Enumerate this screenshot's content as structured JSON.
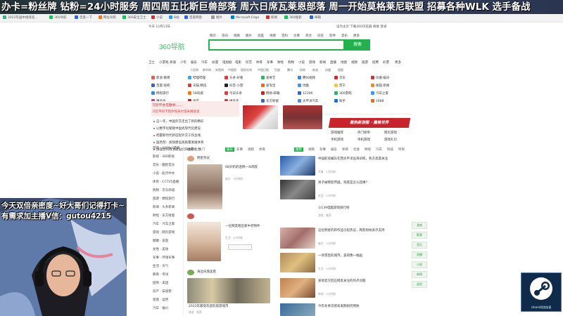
{
  "stream_banner": "办卡=粉丝牌  钻粉=24小时服务 周四周五比斯巨兽部落 周六日席瓦莱恩部落 周一开始莫格莱尼联盟 招募各种WLK 选手备战",
  "bookmarks": [
    "2022年国中组排名...",
    "360导航",
    "百度一下",
    "网址导航",
    "360安全卫士",
    "小说",
    "B站",
    "百度网盘",
    "图片",
    "Microsoft Edge",
    "新闻",
    "360搜索",
    "邮箱"
  ],
  "browser": {
    "logo_main": "360",
    "logo_suffix": "导航",
    "search_tabs": [
      "网页",
      "资讯",
      "视频",
      "图片",
      "良医",
      "地图",
      "百科",
      "文库",
      "英文",
      "问答",
      "软件",
      "音乐",
      "更多"
    ],
    "search_button": "搜索",
    "top_right": [
      "设为主页",
      "下载360浏览器",
      "换肤",
      "登录"
    ],
    "header_left": "今天 12月13日",
    "nav_items": [
      "卫士",
      "小游戏",
      "商城",
      "少年",
      "娱乐",
      "汽车",
      "动漫",
      "电视剧",
      "电影",
      "综艺",
      "体育",
      "军事",
      "财经",
      "购物",
      "小说",
      "游戏",
      "新闻",
      "直播",
      "地图",
      "视频",
      "旅游",
      "招聘",
      "彩票",
      "更多"
    ],
    "hotlinks_row1": [
      "人民网",
      "新华网",
      "央视网",
      "中国网",
      "国际在线",
      "中国日报",
      "百度",
      "腾讯",
      "网易",
      "新浪",
      "凤凰",
      "搜狐"
    ],
    "sites": [
      [
        "新浪·微博",
        "哔哩哔哩",
        "头条·好看",
        "爱奇艺",
        "腾讯视频",
        "京东",
        "凤凰·娱乐"
      ],
      [
        "百度·贴吧",
        "天猫·精选",
        "抖音·小游",
        "爱淘宝",
        "优酷",
        "苏宁",
        "搜狐·新闻"
      ],
      [
        "携程旅行",
        "58同城",
        "今日头条",
        "网易·邮箱",
        "12306",
        "360游戏",
        "汽车之家"
      ],
      [
        "唯品会",
        "国美",
        "拼多多",
        "东方财富",
        "太平洋汽车",
        "知乎",
        "1688"
      ]
    ],
    "headline_main": "习近平会见欧洲……",
    "headlines": [
      "习近平同卡塔尔埃米尔塔米姆会谈",
      "这一年，中国外交走出了新的精彩",
      "以数字化赋能中国式现代化建设",
      "把握新时代新征程外交工作主线",
      "国务院：加快建设高质量发展体系",
      "加强党的政治建设提升执政能力"
    ],
    "game_banner": "最热新游服 · 魔兽世界",
    "game_links": [
      "游戏推荐",
      "热门榜单",
      "网页游戏",
      "手机游戏",
      "单机游戏",
      "游戏礼包"
    ],
    "left_menu": [
      "游戏 · 4399小游戏",
      "影视 · 360影视",
      "音乐 · 酷狗音乐",
      "小说 · 起点中文",
      "体育 · CCTV5直播",
      "购物 · 京东商城",
      "旅游 · 携程旅行",
      "新闻 · 头条新闻",
      "财经 · 东方财富",
      "汽车 · 汽车之家",
      "游戏 · 网页游戏",
      "健康 · 良医",
      "女性 · 美妆",
      "军事 · 环球军事",
      "生活 · 天气",
      "教育 · 考试",
      "团购 · 美团",
      "房产 · 安居客",
      "星座 · 运势",
      "汽车 · 报价"
    ],
    "feed_tabs_left": [
      "推荐",
      "热门",
      "娱乐",
      "军事",
      "视频",
      "体育"
    ],
    "feed_tabs_right": [
      "推荐",
      "视频",
      "军事",
      "娱乐",
      "体育",
      "社会",
      "财经",
      "汽车",
      "科技",
      "时尚",
      "游戏",
      "房产"
    ],
    "mid_feed": [
      {
        "title": "明星热议",
        "sub": "热门推荐"
      },
      {
        "title": "68岁奶奶迷倒一众网友",
        "sub": "娱乐 · 3分钟前"
      },
      {
        "title": "一位网友晒出家中老物件",
        "sub": "生活 · 1小时前"
      },
      {
        "title": "海边日落美景",
        "sub": "风景 · 推荐"
      },
      {
        "title": "2022年最受欢迎的旅游城市",
        "sub": "旅游 · 推荐"
      }
    ],
    "right_feed": [
      {
        "title": "中国航母编队在西太平洋远海训练，各方高度关注",
        "sub": "军事 · 1小时前"
      },
      {
        "title": "男子被网友怀疑，到底是怎么回事？",
        "sub": "社会 · 2小时前"
      },
      {
        "title": "1/139电脑游戏排行榜",
        "sub": "游戏 · 推荐"
      },
      {
        "title": "这位明星的新作品引起热议，网友纷纷表示支持",
        "sub": "娱乐 · 3小时前"
      },
      {
        "title": "一场雪后的城市，美得像一幅画",
        "sub": "生活 · 4小时前"
      },
      {
        "title": "某地官方回应网友关注的热点问题",
        "sub": "新闻 · 5小时前"
      },
      {
        "title": "今年冬季流感高发期如何预防",
        "sub": "健康 · 推荐"
      }
    ],
    "side_buttons": [
      "游戏",
      "影视",
      "音乐",
      "直播",
      "小说",
      "新闻",
      "返回"
    ]
  },
  "overlay": {
    "line1": "今天双倍亲密度~好大哥们记得打卡~",
    "line2": "有需求加主播V信：gutou4215"
  },
  "steam_label": "steam网游加速",
  "colors": {
    "brand": "#23b14d",
    "accent_red": "#c9232b"
  }
}
